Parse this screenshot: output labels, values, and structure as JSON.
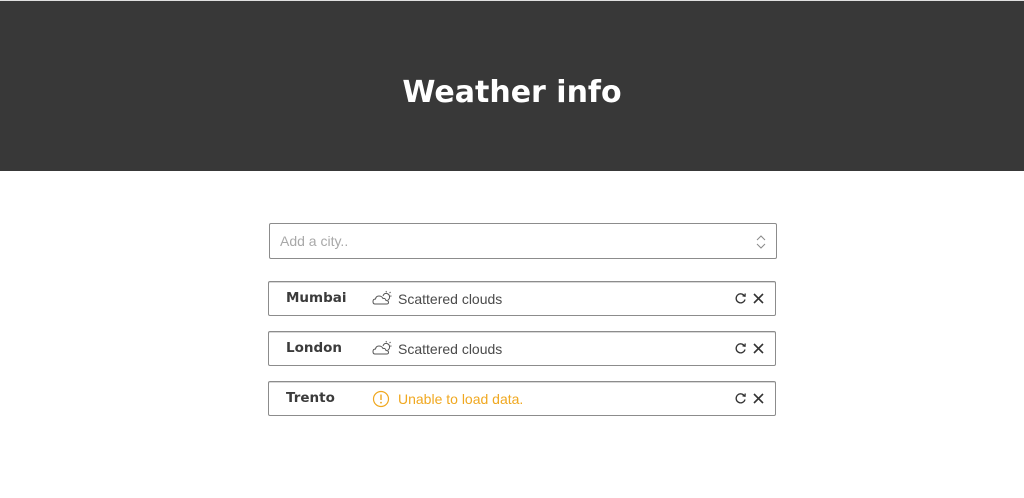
{
  "header": {
    "title": "Weather info"
  },
  "search": {
    "placeholder": "Add a city.."
  },
  "cities": [
    {
      "name": "Mumbai",
      "status": "Scattered clouds",
      "icon": "scattered-clouds-icon",
      "state": "ok"
    },
    {
      "name": "London",
      "status": "Scattered clouds",
      "icon": "scattered-clouds-icon",
      "state": "ok"
    },
    {
      "name": "Trento",
      "status": "Unable to load data.",
      "icon": "warning-icon",
      "state": "error"
    }
  ],
  "colors": {
    "header_bg": "#383838",
    "error": "#f0a820",
    "border": "#8c8c8c"
  }
}
